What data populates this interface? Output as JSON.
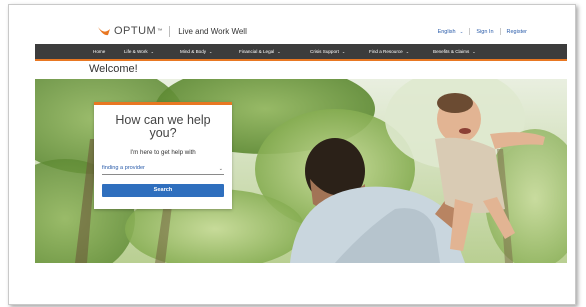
{
  "header": {
    "logo_text": "OPTUM",
    "logo_tm": "™",
    "tagline": "Live and Work Well",
    "language": "English",
    "sign_in": "Sign In",
    "register": "Register"
  },
  "nav": {
    "items": [
      {
        "label": "Home",
        "has_menu": false
      },
      {
        "label": "Life & Work",
        "has_menu": true
      },
      {
        "label": "Mind & Body",
        "has_menu": true
      },
      {
        "label": "Financial & Legal",
        "has_menu": true
      },
      {
        "label": "Crisis Support",
        "has_menu": true
      },
      {
        "label": "Find a Resource",
        "has_menu": true
      },
      {
        "label": "Benefits & Claims",
        "has_menu": true
      }
    ]
  },
  "page": {
    "welcome": "Welcome!"
  },
  "card": {
    "title": "How can we help you?",
    "subtitle": "I'm here to get help with",
    "select_value": "finding a provider",
    "search_label": "Search"
  },
  "icons": {
    "chevron": "chevron-down-icon",
    "logo": "optum-logo-icon"
  },
  "colors": {
    "accent_orange": "#e87722",
    "nav_bg": "#3c3c3c",
    "link_blue": "#2a5caa",
    "button_blue": "#2f6fbe"
  }
}
